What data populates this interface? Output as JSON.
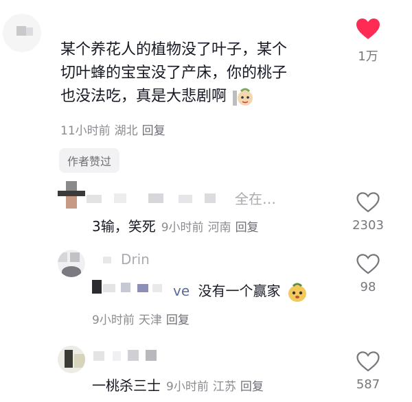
{
  "main_comment": {
    "lines": [
      "某个养花人的植物没了叶子，某个",
      "切叶蜂的宝宝没了产床，你的桃子",
      "也没法吃，真是大悲剧啊"
    ],
    "time": "11小时前",
    "location": "湖北",
    "reply_label": "回复",
    "like_count": "1万",
    "liked": true,
    "author_badge": "作者赞过"
  },
  "replies": [
    {
      "name_fragment": "全在…",
      "text": "3输，笑死",
      "time": "9小时前",
      "location": "河南",
      "reply_label": "回复",
      "like_count": "2303"
    },
    {
      "name_fragment": "Drin",
      "reply_to_fragment": "ve",
      "text": "没有一个赢家",
      "time": "9小时前",
      "location": "天津",
      "reply_label": "回复",
      "like_count": "98"
    },
    {
      "text": "一桃杀三士",
      "time": "9小时前",
      "location": "江苏",
      "reply_label": "回复",
      "like_count": "587"
    }
  ],
  "colors": {
    "like_red": "#fe2c55",
    "meta_gray": "#8a8b91",
    "text": "#161823"
  },
  "icons": {
    "heart_filled": "heart-filled-icon",
    "heart_outline": "heart-outline-icon",
    "emoji": "emoji-sticker-icon"
  }
}
